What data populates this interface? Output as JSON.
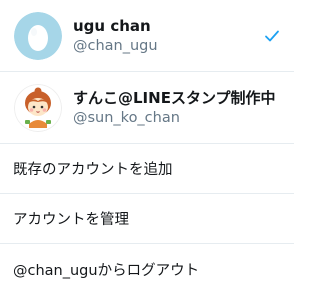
{
  "accounts": [
    {
      "display_name": "ugu chan",
      "handle": "@chan_ugu",
      "avatar_icon": "egg-avatar-icon",
      "selected": true
    },
    {
      "display_name": "すんこ@LINEスタンプ制作中",
      "handle": "@sun_ko_chan",
      "avatar_icon": "character-avatar-icon",
      "selected": false
    }
  ],
  "actions": {
    "add_existing_account": "既存のアカウントを追加",
    "manage_accounts": "アカウントを管理",
    "logout": "@chan_uguからログアウト"
  },
  "colors": {
    "accent": "#1da1f2",
    "egg_background": "#a6d6e8",
    "divider": "#e6ecf0",
    "secondary_text": "#657786"
  }
}
